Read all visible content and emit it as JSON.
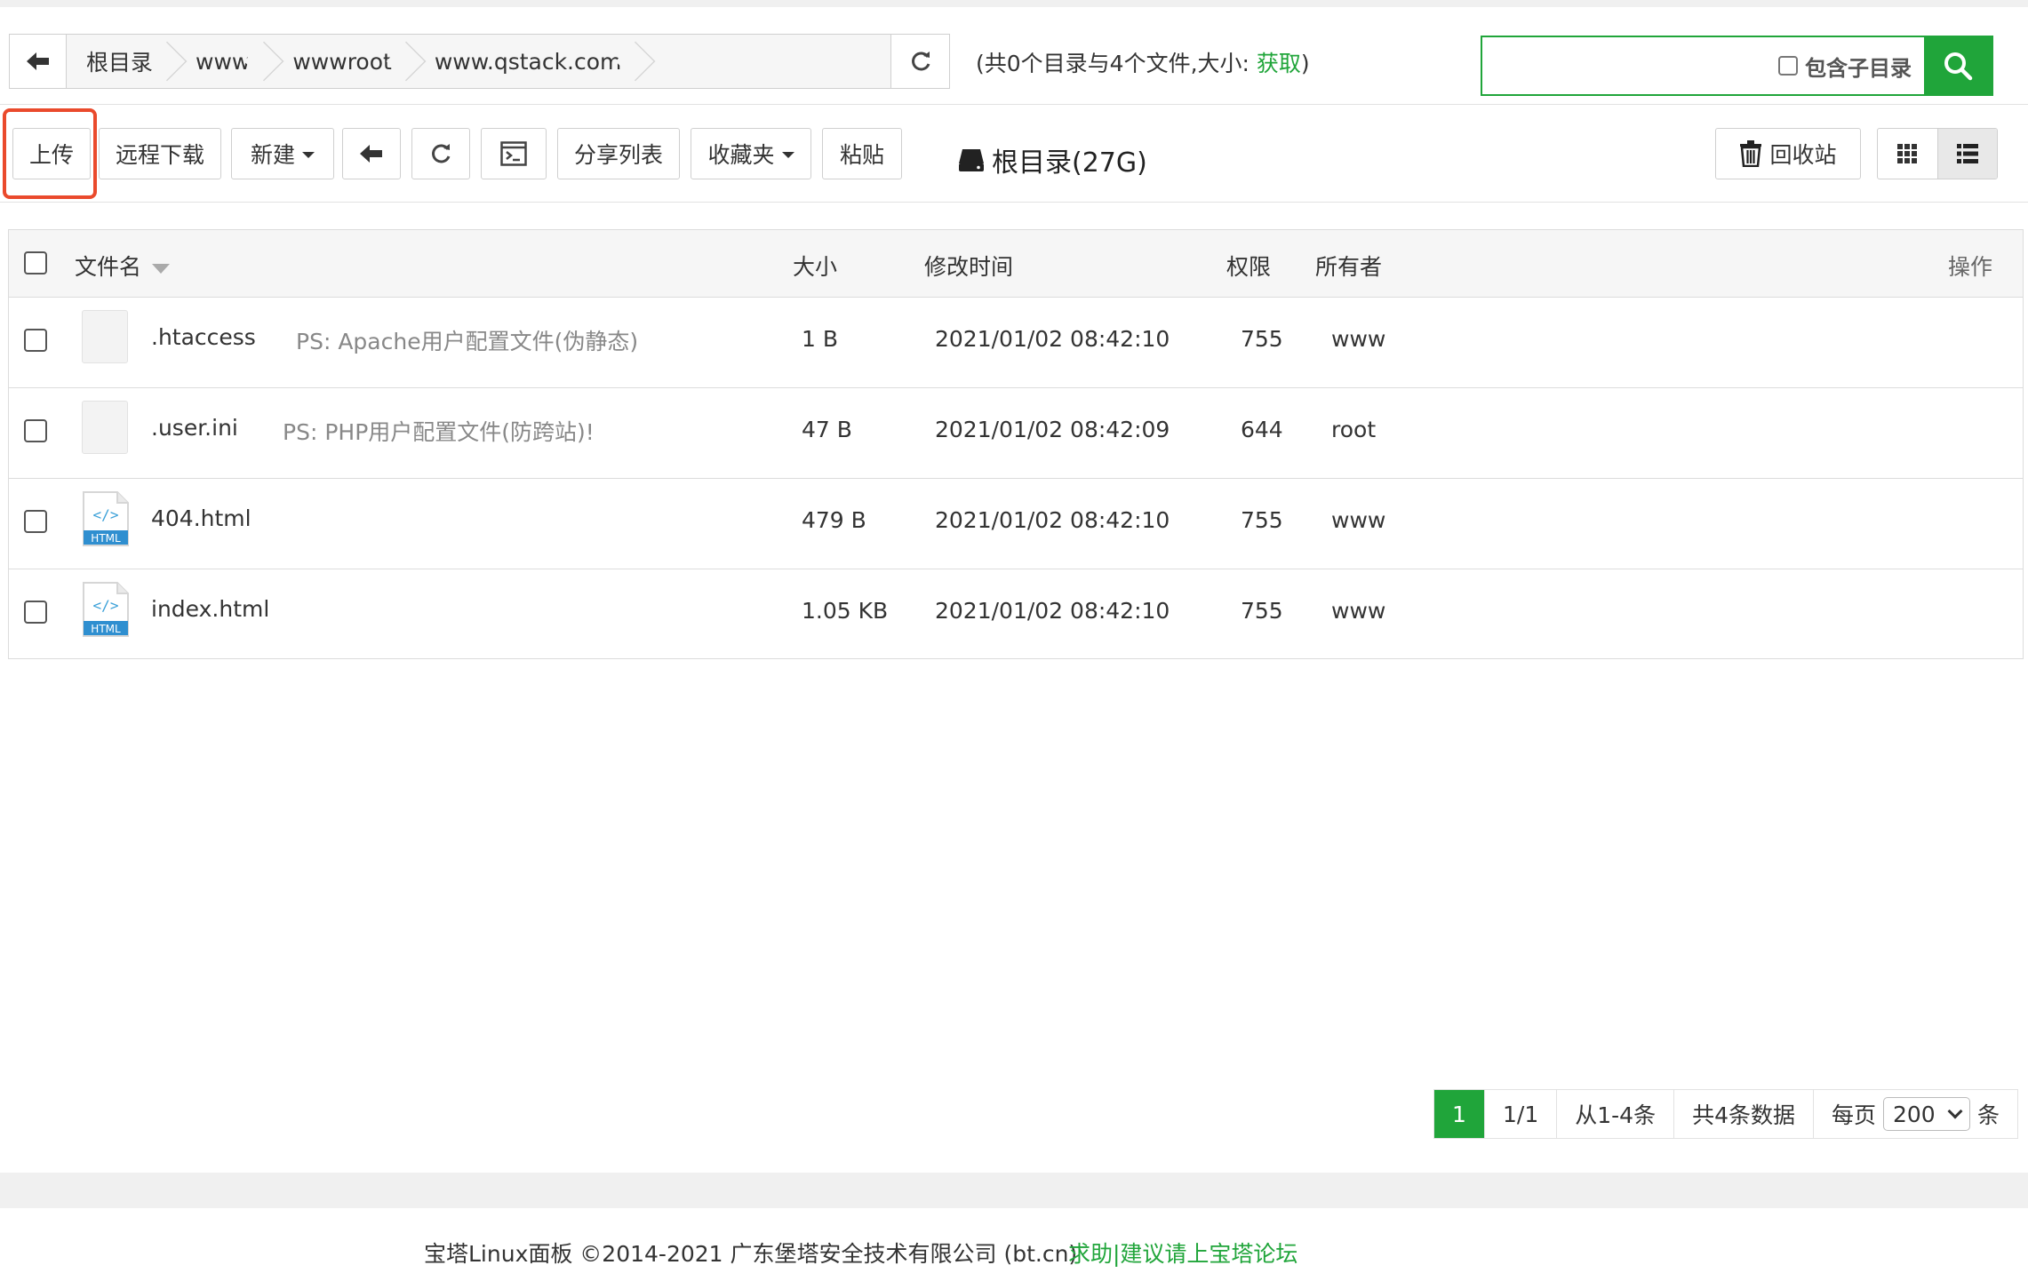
{
  "path": {
    "crumbs": [
      "根目录",
      "www",
      "wwwroot",
      "www.qstack.com"
    ],
    "info_prefix": "(共0个目录与4个文件,大小: ",
    "info_link": "获取",
    "info_suffix": ")"
  },
  "search": {
    "placeholder": "",
    "include_subdir_label": "包含子目录"
  },
  "toolbar": {
    "upload": "上传",
    "remote_download": "远程下载",
    "new": "新建",
    "share_list": "分享列表",
    "favorites": "收藏夹",
    "paste": "粘贴",
    "disk_label": "根目录(27G)",
    "recycle_bin": "回收站"
  },
  "table": {
    "headers": {
      "name": "文件名",
      "size": "大小",
      "mtime": "修改时间",
      "perm": "权限",
      "owner": "所有者",
      "actions": "操作"
    },
    "rows": [
      {
        "name": ".htaccess",
        "note": "PS: Apache用户配置文件(伪静态)",
        "size": "1 B",
        "mtime": "2021/01/02 08:42:10",
        "perm": "755",
        "owner": "www",
        "icon": "blank-file-icon"
      },
      {
        "name": ".user.ini",
        "note": "PS: PHP用户配置文件(防跨站)!",
        "size": "47 B",
        "mtime": "2021/01/02 08:42:09",
        "perm": "644",
        "owner": "root",
        "icon": "blank-file-icon"
      },
      {
        "name": "404.html",
        "note": "",
        "size": "479 B",
        "mtime": "2021/01/02 08:42:10",
        "perm": "755",
        "owner": "www",
        "icon": "html-file-icon"
      },
      {
        "name": "index.html",
        "note": "",
        "size": "1.05 KB",
        "mtime": "2021/01/02 08:42:10",
        "perm": "755",
        "owner": "www",
        "icon": "html-file-icon"
      }
    ]
  },
  "pager": {
    "current": "1",
    "pages": "1/1",
    "range": "从1-4条",
    "total": "共4条数据",
    "per_page_label": "每页",
    "per_page_value": "200",
    "per_page_suffix": "条"
  },
  "footer": {
    "copyright": "宝塔Linux面板 ©2014-2021 广东堡塔安全技术有限公司 (bt.cn)",
    "help_link": "求助|建议请上宝塔论坛"
  },
  "colors": {
    "accent": "#20a53a",
    "highlight": "#ea4a2c"
  }
}
